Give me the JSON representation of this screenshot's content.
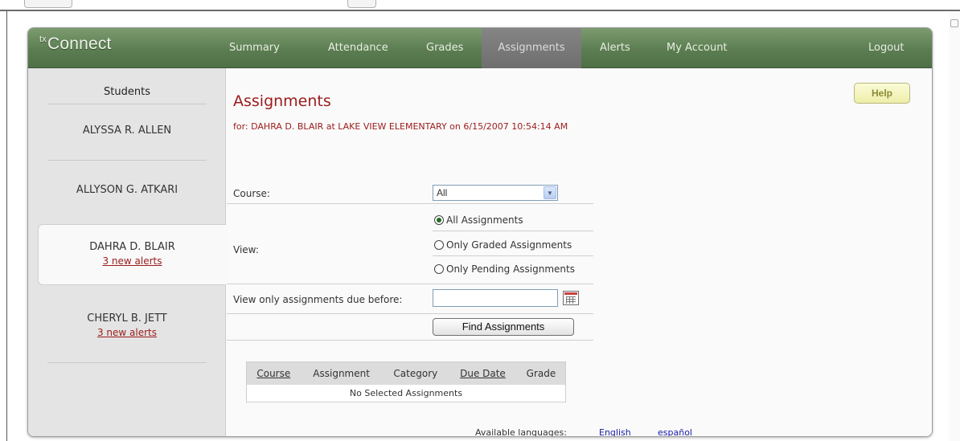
{
  "app": {
    "logo_prefix": "tx",
    "logo_name": "Connect"
  },
  "nav": {
    "items": [
      {
        "label": "Summary"
      },
      {
        "label": "Attendance"
      },
      {
        "label": "Grades"
      },
      {
        "label": "Assignments",
        "active": true
      },
      {
        "label": "Alerts"
      },
      {
        "label": "My Account"
      }
    ],
    "logout": "Logout"
  },
  "sidebar": {
    "title": "Students",
    "students": [
      {
        "name": "ALYSSA R. ALLEN",
        "alerts": ""
      },
      {
        "name": "ALLYSON G. ATKARI",
        "alerts": ""
      },
      {
        "name": "DAHRA D. BLAIR",
        "alerts": "3 new alerts",
        "selected": true
      },
      {
        "name": "CHERYL B. JETT",
        "alerts": "3 new alerts"
      }
    ]
  },
  "main": {
    "help_label": "Help",
    "title": "Assignments",
    "subtitle": "for: DAHRA D. BLAIR at LAKE VIEW ELEMENTARY on 6/15/2007 10:54:14 AM",
    "form": {
      "course_label": "Course:",
      "course_value": "All",
      "view_label": "View:",
      "view_options": [
        "All Assignments",
        "Only Graded Assignments",
        "Only Pending Assignments"
      ],
      "view_selected": "All Assignments",
      "due_before_label": "View only assignments due before:",
      "due_before_value": "",
      "find_button": "Find Assignments"
    },
    "table": {
      "columns": [
        "Course",
        "Assignment",
        "Category",
        "Due Date",
        "Grade"
      ],
      "empty_message": "No Selected Assignments"
    },
    "languages": {
      "label": "Available languages:",
      "options": [
        "English",
        "español"
      ]
    }
  },
  "colors": {
    "nav_green": "#5c7d52",
    "nav_active_gray": "#787878",
    "title_red": "#9b1b1b",
    "link_blue": "#1a1aa8",
    "help_yellow": "#eeeeaa"
  }
}
